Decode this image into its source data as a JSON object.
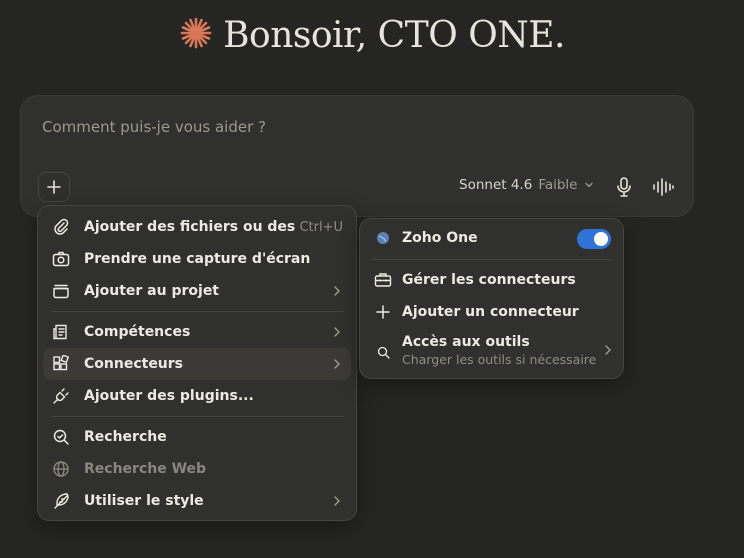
{
  "greeting": {
    "text": "Bonsoir, CTO ONE.",
    "icon": "sparkle-icon",
    "icon_color": "#D97757"
  },
  "composer": {
    "placeholder": "Comment puis-je vous aider ?",
    "model": "Sonnet 4.6",
    "effort": "Faible"
  },
  "menu": {
    "items": [
      {
        "label": "Ajouter des fichiers ou des ...",
        "shortcut": "Ctrl+U",
        "icon": "paperclip-icon"
      },
      {
        "label": "Prendre une capture d'écran",
        "icon": "camera-icon"
      },
      {
        "label": "Ajouter au projet",
        "icon": "folder-icon"
      },
      {
        "label": "Compétences",
        "icon": "skills-icon"
      },
      {
        "label": "Connecteurs",
        "icon": "connectors-icon"
      },
      {
        "label": "Ajouter des plugins...",
        "icon": "plug-icon"
      },
      {
        "label": "Recherche",
        "icon": "research-icon"
      },
      {
        "label": "Recherche Web",
        "icon": "globe-icon"
      },
      {
        "label": "Utiliser le style",
        "icon": "feather-icon"
      }
    ]
  },
  "connectors": {
    "zoho": {
      "label": "Zoho One",
      "enabled": true
    },
    "manage": "Gérer les connecteurs",
    "add": "Ajouter un connecteur",
    "tools": {
      "label": "Accès aux outils",
      "desc": "Charger les outils si nécessaire"
    }
  },
  "colors": {
    "accent": "#D97757",
    "toggle": "#2F73D9",
    "background": "#252523"
  }
}
